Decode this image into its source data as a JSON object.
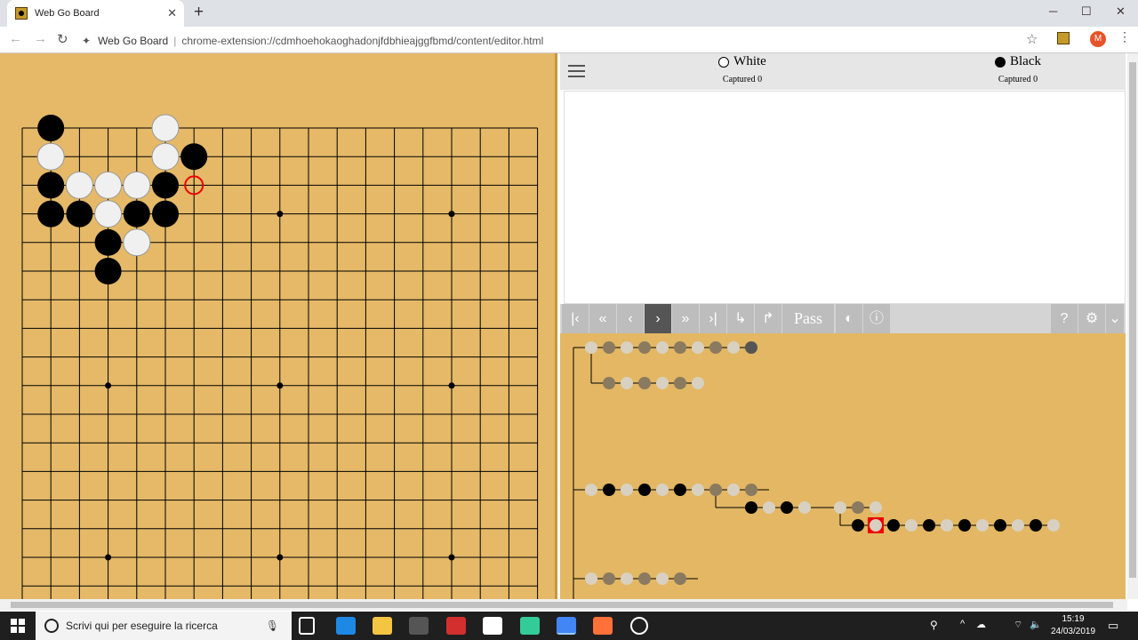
{
  "browser": {
    "tab_title": "Web Go Board",
    "address_label": "Web Go Board",
    "address_url": "chrome-extension://cdmhoehokaoghadonjfdbhieajggfbmd/content/editor.html",
    "avatar_letter": "M"
  },
  "players": {
    "white": {
      "name": "White",
      "captured": "Captured 0"
    },
    "black": {
      "name": "Black",
      "captured": "Captured 0"
    }
  },
  "toolbar": {
    "pass_label": "Pass",
    "buttons": [
      "first-move",
      "back-many",
      "back",
      "forward",
      "forward-many",
      "last-move",
      "up-branch",
      "down-branch"
    ]
  },
  "board": {
    "size": 19,
    "star_points": [
      [
        3,
        3
      ],
      [
        9,
        3
      ],
      [
        15,
        3
      ],
      [
        3,
        9
      ],
      [
        9,
        9
      ],
      [
        15,
        9
      ],
      [
        3,
        15
      ],
      [
        9,
        15
      ],
      [
        15,
        15
      ]
    ],
    "black_stones": [
      [
        1,
        0
      ],
      [
        6,
        1
      ],
      [
        1,
        2
      ],
      [
        5,
        2
      ],
      [
        1,
        3
      ],
      [
        2,
        3
      ],
      [
        4,
        3
      ],
      [
        5,
        3
      ],
      [
        3,
        4
      ],
      [
        3,
        5
      ]
    ],
    "white_stones": [
      [
        5,
        0
      ],
      [
        1,
        1
      ],
      [
        5,
        1
      ],
      [
        2,
        2
      ],
      [
        3,
        2
      ],
      [
        4,
        2
      ],
      [
        3,
        3
      ],
      [
        4,
        4
      ]
    ],
    "last_move_marker": [
      6,
      2
    ]
  },
  "taskbar": {
    "search_placeholder": "Scrivi qui per eseguire la ricerca",
    "time": "15:19",
    "date": "24/03/2019"
  }
}
